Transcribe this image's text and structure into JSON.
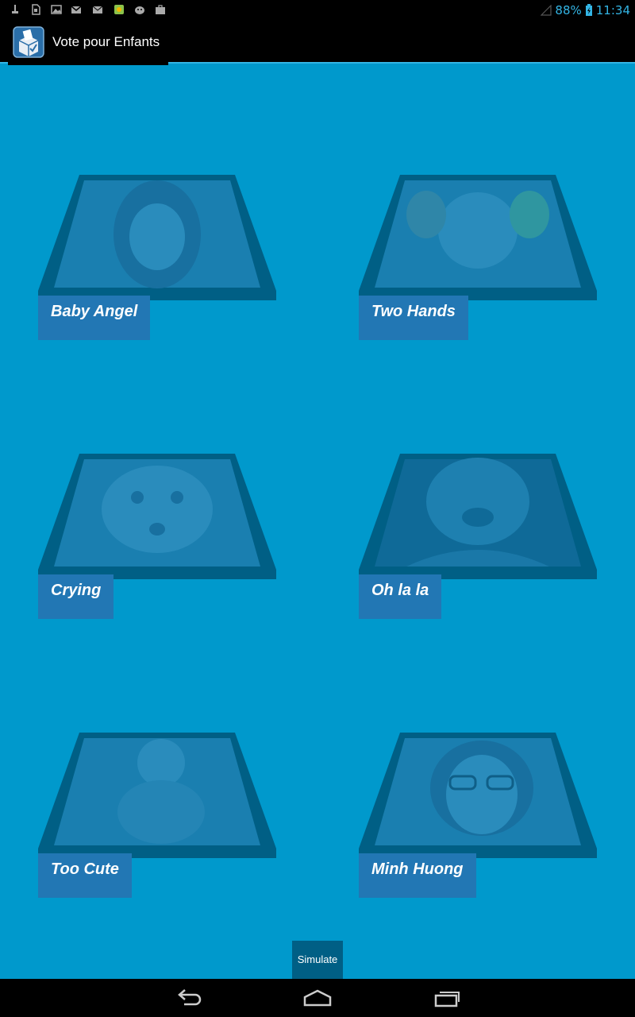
{
  "status_bar": {
    "battery": "88%",
    "time": "11:34",
    "left_icons": [
      "usb-debug-icon",
      "sd-card-icon",
      "image-icon",
      "gmail-icon",
      "mail-icon",
      "play-store-icon",
      "android-icon",
      "briefcase-icon"
    ]
  },
  "app": {
    "title": "Vote pour Enfants"
  },
  "candidates": [
    {
      "label": "Baby Angel"
    },
    {
      "label": "Two Hands"
    },
    {
      "label": "Crying"
    },
    {
      "label": "Oh la la"
    },
    {
      "label": "Too Cute"
    },
    {
      "label": "Minh Huong"
    }
  ],
  "simulate_label": "Simulate",
  "colors": {
    "background": "#0099cc",
    "label_bg": "#2277b4",
    "frame": "#005f85",
    "accent": "#33b5e5"
  }
}
